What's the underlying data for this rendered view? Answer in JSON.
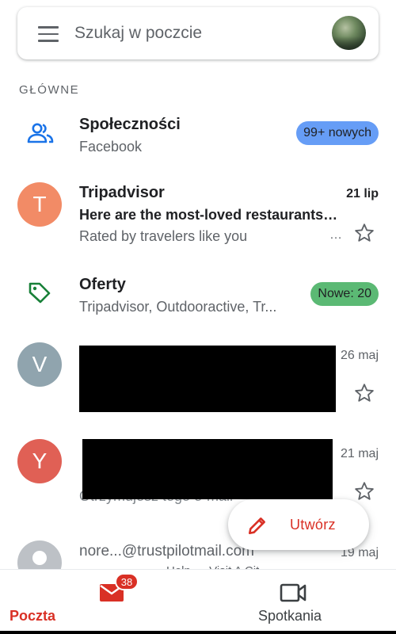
{
  "search": {
    "placeholder": "Szukaj w poczcie"
  },
  "section": {
    "label": "GŁÓWNE"
  },
  "categories": [
    {
      "title": "Społeczności",
      "subtitle": "Facebook",
      "badge": "99+ nowych",
      "badge_color": "#669df6",
      "icon": "people-icon"
    },
    {
      "title": "Oferty",
      "subtitle": "Tripadvisor, Outdooractive, Tr...",
      "badge": "Nowe: 20",
      "badge_color": "#5bb974",
      "icon": "tag-icon"
    }
  ],
  "emails": [
    {
      "avatar_letter": "T",
      "avatar_color": "#f28b66",
      "sender": "Tripadvisor",
      "date": "21 lip",
      "subject": "Here are the most-loved restaurants…",
      "snippet": "Rated by travelers like you",
      "unread": true
    },
    {
      "avatar_letter": "V",
      "avatar_color": "#90a4ae",
      "date": "26 maj",
      "redacted": true
    },
    {
      "avatar_letter": "Y",
      "avatar_color": "#e06055",
      "date": "21 maj",
      "snippet_partial": "Otrzymujesz tego e-mail",
      "redacted": true
    },
    {
      "sender": "nore...@trustpilotmail.com",
      "date": "19 maj",
      "snippet": "Help … Visit A Cit"
    }
  ],
  "compose": {
    "label": "Utwórz"
  },
  "bottom_nav": {
    "mail": {
      "label": "Poczta",
      "count": "38"
    },
    "meet": {
      "label": "Spotkania"
    }
  },
  "colors": {
    "accent": "#d93025",
    "people_icon": "#1a73e8",
    "tag_icon": "#188038"
  }
}
